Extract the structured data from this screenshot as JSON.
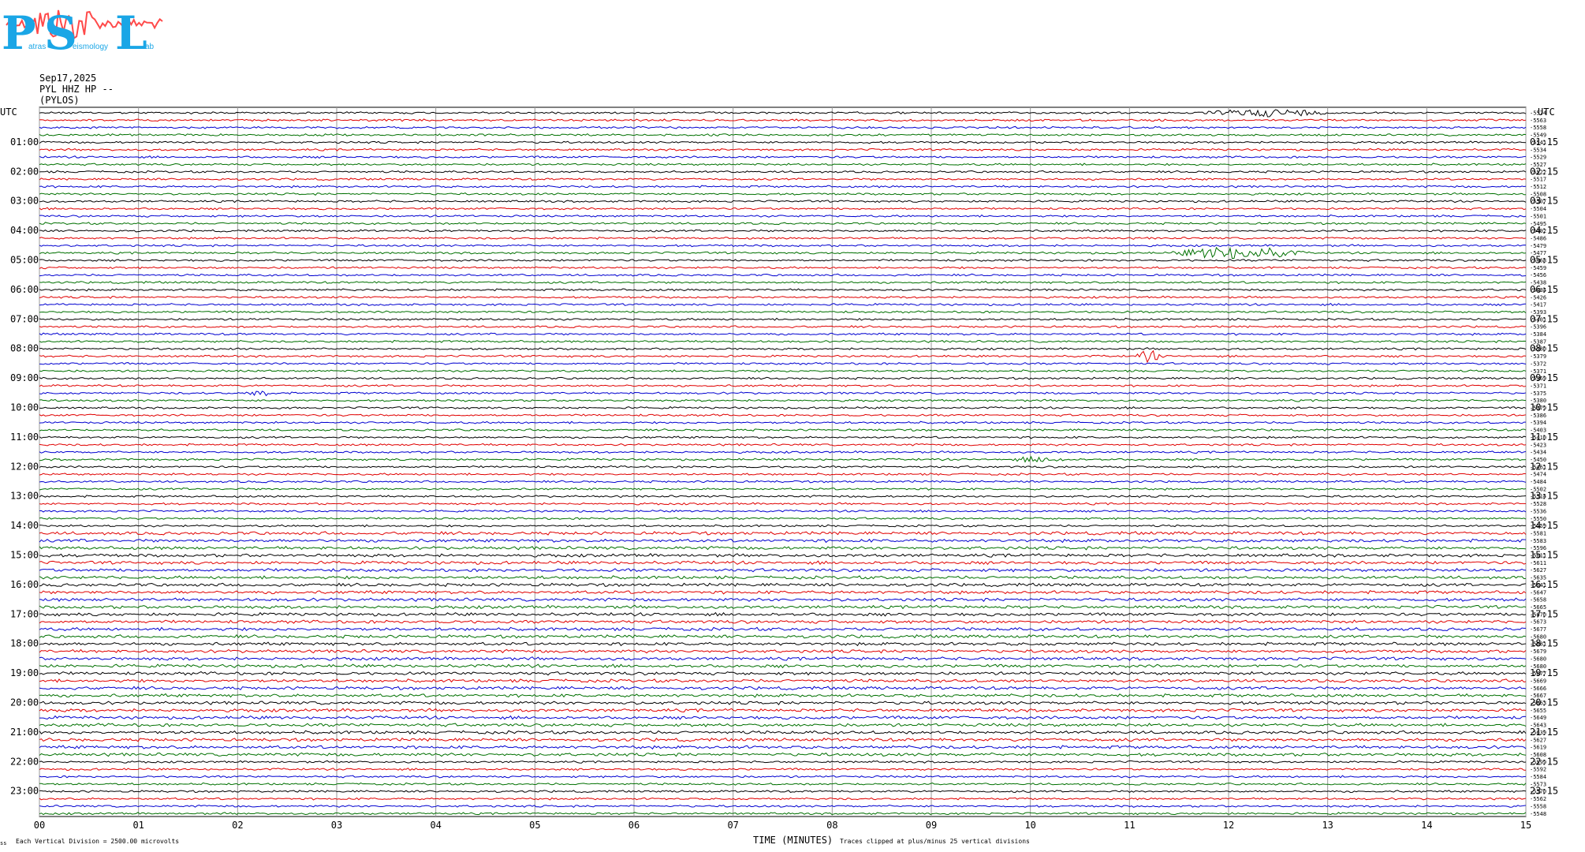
{
  "header": {
    "logo_letters": [
      "P",
      "S",
      "L"
    ],
    "logo_words": [
      "atras",
      "eismology",
      "ab"
    ],
    "date": "Sep17,2025",
    "channel": "PYL HHZ HP --",
    "station": "(PYLOS)"
  },
  "chart_data": {
    "type": "line",
    "title": "",
    "xlabel": "TIME (MINUTES)",
    "ylabel": "",
    "left_axis_label": "UTC",
    "right_axis_label": "UTC",
    "xlim": [
      0,
      15
    ],
    "x_ticks": [
      "00",
      "01",
      "02",
      "03",
      "04",
      "05",
      "06",
      "07",
      "08",
      "09",
      "10",
      "11",
      "12",
      "13",
      "14",
      "15"
    ],
    "left_hour_labels": [
      "01:00",
      "02:00",
      "03:00",
      "04:00",
      "05:00",
      "06:00",
      "07:00",
      "08:00",
      "09:00",
      "10:00",
      "11:00",
      "12:00",
      "13:00",
      "14:00",
      "15:00",
      "16:00",
      "17:00",
      "18:00",
      "19:00",
      "20:00",
      "21:00",
      "22:00",
      "23:00"
    ],
    "right_hour_labels": [
      "01:15",
      "02:15",
      "03:15",
      "04:15",
      "05:15",
      "06:15",
      "07:15",
      "08:15",
      "09:15",
      "10:15",
      "11:15",
      "12:15",
      "13:15",
      "14:15",
      "15:15",
      "16:15",
      "17:15",
      "18:15",
      "19:15",
      "20:15",
      "21:15",
      "22:15",
      "23:15"
    ],
    "trace_count": 96,
    "trace_colors": [
      "#000000",
      "#e00000",
      "#0000d0",
      "#007000"
    ],
    "trace_offsets": [
      -5574,
      -5563,
      -5558,
      -5549,
      -5541,
      -5534,
      -5529,
      -5527,
      -5522,
      -5517,
      -5512,
      -5508,
      -5507,
      -5504,
      -5501,
      -5495,
      -5492,
      -5486,
      -5479,
      -5477,
      -5468,
      -5459,
      -5456,
      -5438,
      -5434,
      -5426,
      -5417,
      -5393,
      -5401,
      -5396,
      -5384,
      -5387,
      -5380,
      -5379,
      -5372,
      -5371,
      -5369,
      -5371,
      -5375,
      -5380,
      -5379,
      -5386,
      -5394,
      -5403,
      -5410,
      -5423,
      -5434,
      -5450,
      -5461,
      -5474,
      -5484,
      -5502,
      -5514,
      -5528,
      -5536,
      -5550,
      -5559,
      -5581,
      -5583,
      -5596,
      -5611,
      -5611,
      -5627,
      -5635,
      -5641,
      -5647,
      -5658,
      -5665,
      -5670,
      -5673,
      -5677,
      -5680,
      -5681,
      -5679,
      -5680,
      -5680,
      -5677,
      -5669,
      -5666,
      -5667,
      -5663,
      -5655,
      -5649,
      -5643,
      -5639,
      -5627,
      -5619,
      -5608,
      -5599,
      -5592,
      -5584,
      -5573,
      -5570,
      -5562,
      -5558,
      -5548,
      -5540
    ],
    "events": [
      {
        "trace": 0,
        "start_min": 11.7,
        "end_min": 13.1,
        "amplitude": 0.55
      },
      {
        "trace": 19,
        "start_min": 11.4,
        "end_min": 12.8,
        "amplitude": 1.0
      },
      {
        "trace": 33,
        "start_min": 11.05,
        "end_min": 11.35,
        "amplitude": 0.9
      },
      {
        "trace": 38,
        "start_min": 2.1,
        "end_min": 2.4,
        "amplitude": 0.5
      },
      {
        "trace": 47,
        "start_min": 9.8,
        "end_min": 10.4,
        "amplitude": 0.4
      }
    ],
    "footer_left": "Each Vertical Division = 2500.00 microvolts",
    "footer_right": "Traces clipped at plus/minus 25 vertical divisions",
    "footer_corner": "ss",
    "grid": true
  }
}
